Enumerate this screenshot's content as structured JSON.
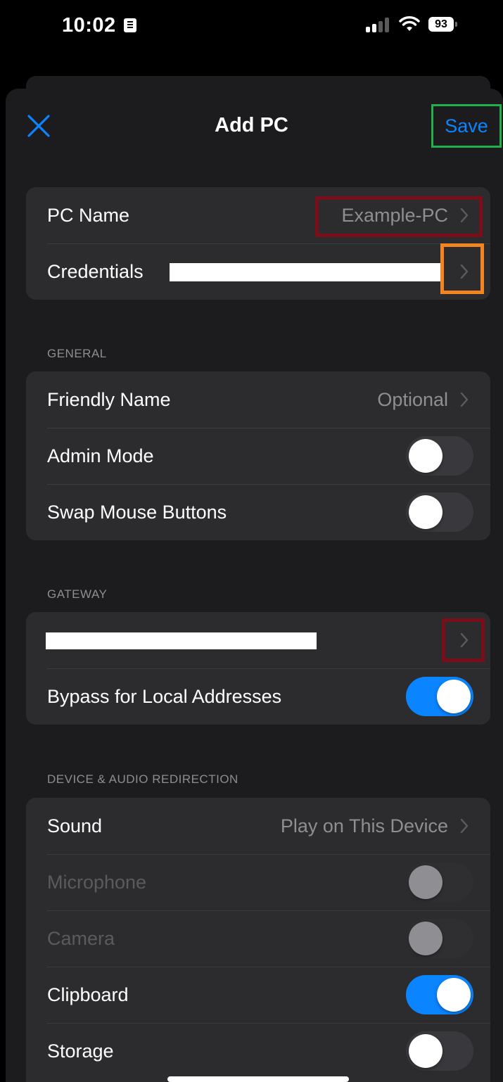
{
  "status_bar": {
    "time": "10:02",
    "battery": "93"
  },
  "nav": {
    "title": "Add PC",
    "save_label": "Save"
  },
  "connection": {
    "pc_name_label": "PC Name",
    "pc_name_value": "Example-PC",
    "credentials_label": "Credentials"
  },
  "general": {
    "header": "GENERAL",
    "friendly_name_label": "Friendly Name",
    "friendly_name_value": "Optional",
    "admin_mode_label": "Admin Mode",
    "admin_mode_on": false,
    "swap_mouse_label": "Swap Mouse Buttons",
    "swap_mouse_on": false
  },
  "gateway": {
    "header": "GATEWAY",
    "bypass_label": "Bypass for Local Addresses",
    "bypass_on": true
  },
  "device_audio": {
    "header": "DEVICE & AUDIO REDIRECTION",
    "sound_label": "Sound",
    "sound_value": "Play on This Device",
    "microphone_label": "Microphone",
    "camera_label": "Camera",
    "clipboard_label": "Clipboard",
    "clipboard_on": true,
    "storage_label": "Storage",
    "storage_on": false
  },
  "colors": {
    "accent": "#0a84ff",
    "save_highlight": "#1fb14b",
    "highlight_dark_red": "#7a0f1a",
    "highlight_orange": "#f28522"
  }
}
